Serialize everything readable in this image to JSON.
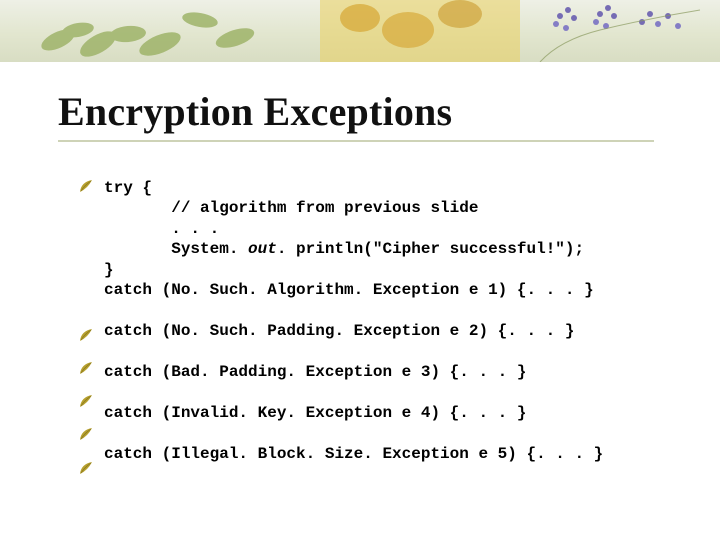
{
  "title": "Encryption Exceptions",
  "code": {
    "l1": "try {",
    "l2": "       // algorithm from previous slide",
    "l3": "       . . .",
    "l4a": "       System. ",
    "l4b": "out",
    "l4c": ". println(\"Cipher successful!\");",
    "l5": "}",
    "l6": "catch (No. Such. Algorithm. Exception e 1) {. . . }",
    "blank": "",
    "l7": "catch (No. Such. Padding. Exception e 2) {. . . }",
    "l8": "catch (Bad. Padding. Exception e 3) {. . . }",
    "l9": "catch (Invalid. Key. Exception e 4) {. . . }",
    "l10": "catch (Illegal. Block. Size. Exception e 5) {. . . }"
  }
}
